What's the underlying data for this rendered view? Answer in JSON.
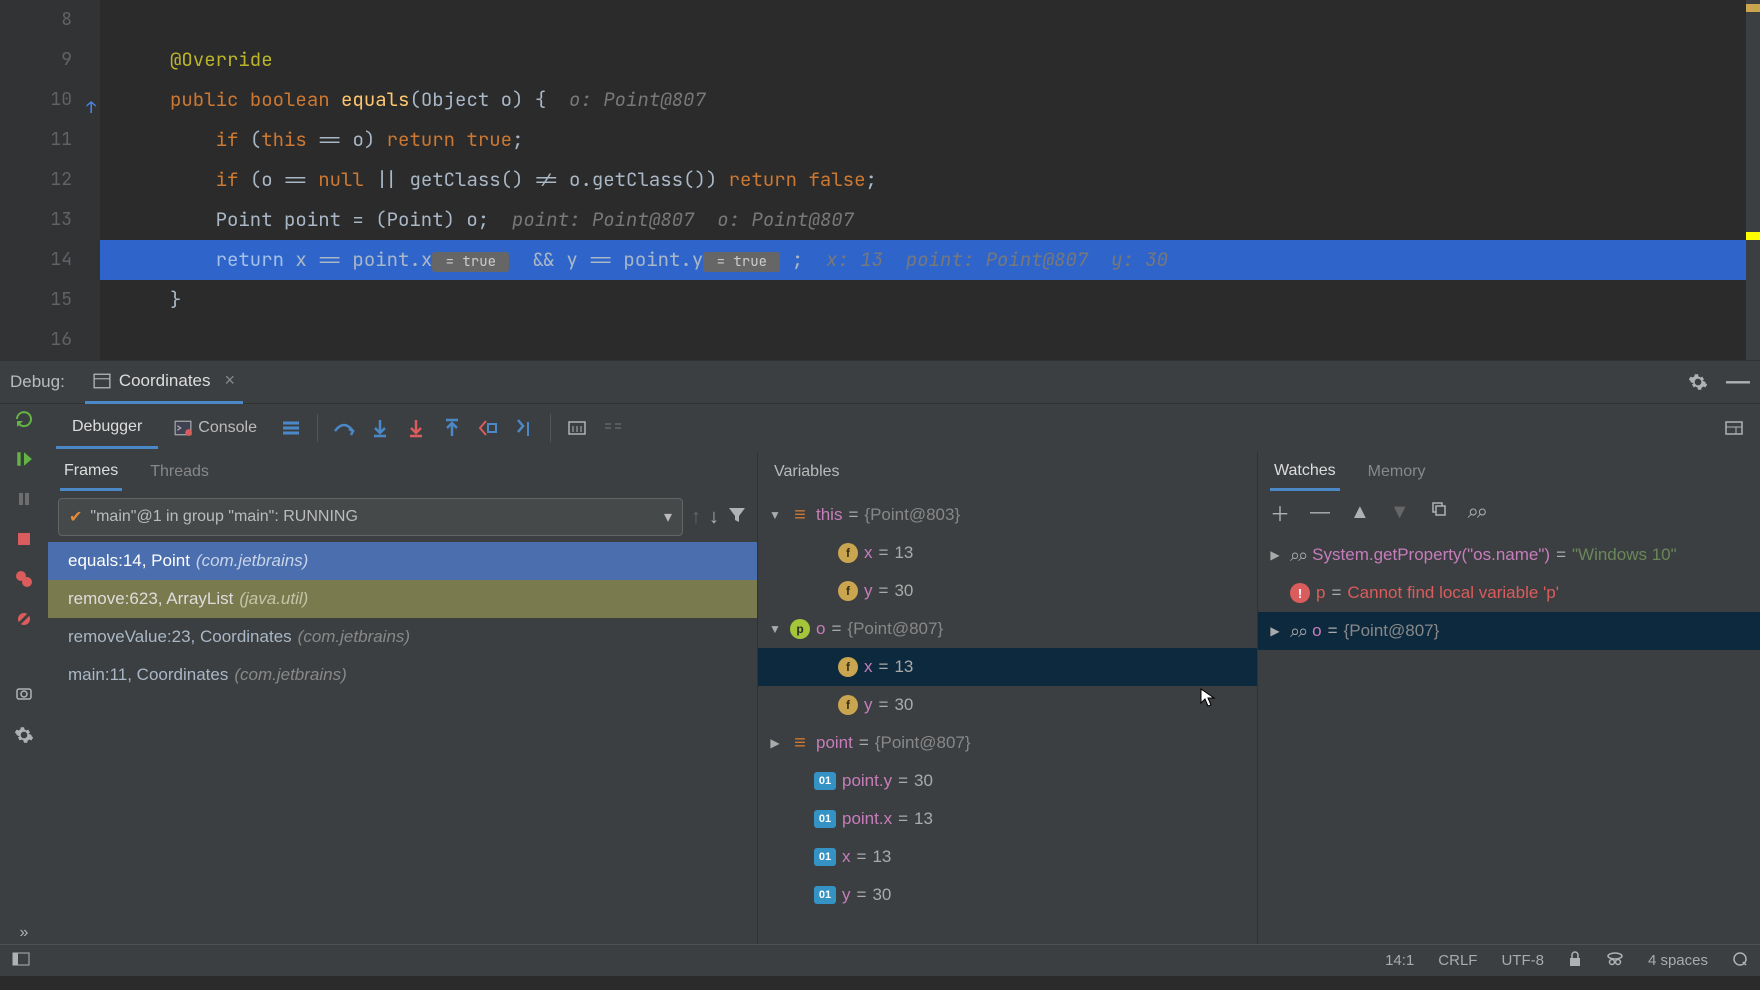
{
  "editor": {
    "lines": [
      {
        "num": "8"
      },
      {
        "num": "9"
      },
      {
        "num": "10"
      },
      {
        "num": "11"
      },
      {
        "num": "12"
      },
      {
        "num": "13"
      },
      {
        "num": "14"
      },
      {
        "num": "15"
      },
      {
        "num": "16"
      }
    ],
    "code": {
      "annotation": "@Override",
      "kw_public": "public",
      "kw_boolean": "boolean",
      "fn_equals": "equals",
      "sig_rest": "(Object o) {",
      "inline_sig": "  o: Point@807",
      "kw_if1": "if",
      "if1_body": " (",
      "kw_this": "this",
      "if1_body2": " == o) ",
      "kw_return1": "return",
      "kw_true": " true",
      "if1_end": ";",
      "kw_if2": "if",
      "if2_body": " (o == ",
      "kw_null": "null",
      "if2_body2": " || getClass() != o.getClass()) ",
      "kw_return2": "return",
      "kw_false": " false",
      "if2_end": ";",
      "l13_a": "Point point = (Point) o;",
      "l13_inline": "  point: Point@807  o: Point@807",
      "kw_return3": "return",
      "l14_a": " x == point.x",
      "l14_box1": " = true ",
      "l14_b": " && y == point.y",
      "l14_box2": " = true ",
      "l14_c": ";",
      "l14_inline": "  x: 13  point: Point@807  y: 30",
      "l15": "}"
    }
  },
  "debugHeader": {
    "label": "Debug:",
    "tabName": "Coordinates"
  },
  "toolbar": {
    "tabs": {
      "debugger": "Debugger",
      "console": "Console"
    }
  },
  "frames": {
    "tabs": {
      "frames": "Frames",
      "threads": "Threads"
    },
    "thread": "\"main\"@1 in group \"main\": RUNNING",
    "items": [
      {
        "text": "equals:14, Point",
        "pkg": "(com.jetbrains)",
        "state": "selected"
      },
      {
        "text": "remove:623, ArrayList",
        "pkg": "(java.util)",
        "state": "lib"
      },
      {
        "text": "removeValue:23, Coordinates",
        "pkg": "(com.jetbrains)",
        "state": ""
      },
      {
        "text": "main:11, Coordinates",
        "pkg": "(com.jetbrains)",
        "state": ""
      }
    ]
  },
  "variables": {
    "title": "Variables",
    "rows": [
      {
        "indent": 0,
        "arrow": "down",
        "badge": "class",
        "name": "this",
        "val": "{Point@803}",
        "valtype": "obj"
      },
      {
        "indent": 2,
        "arrow": "",
        "badge": "field",
        "name": "x",
        "val": "13",
        "valtype": "num"
      },
      {
        "indent": 2,
        "arrow": "",
        "badge": "field",
        "name": "y",
        "val": "30",
        "valtype": "num"
      },
      {
        "indent": 0,
        "arrow": "down",
        "badge": "param",
        "name": "o",
        "val": "{Point@807}",
        "valtype": "obj"
      },
      {
        "indent": 2,
        "arrow": "",
        "badge": "field",
        "name": "x",
        "val": "13",
        "valtype": "num",
        "selected": true
      },
      {
        "indent": 2,
        "arrow": "",
        "badge": "field",
        "name": "y",
        "val": "30",
        "valtype": "num"
      },
      {
        "indent": 0,
        "arrow": "right",
        "badge": "class",
        "name": "point",
        "val": "{Point@807}",
        "valtype": "obj"
      },
      {
        "indent": 1,
        "arrow": "",
        "badge": "int",
        "name": "point.y",
        "val": "30",
        "valtype": "num"
      },
      {
        "indent": 1,
        "arrow": "",
        "badge": "int",
        "name": "point.x",
        "val": "13",
        "valtype": "num"
      },
      {
        "indent": 1,
        "arrow": "",
        "badge": "int",
        "name": "x",
        "val": "13",
        "valtype": "num"
      },
      {
        "indent": 1,
        "arrow": "",
        "badge": "int",
        "name": "y",
        "val": "30",
        "valtype": "num"
      }
    ]
  },
  "watches": {
    "tabs": {
      "watches": "Watches",
      "memory": "Memory"
    },
    "rows": [
      {
        "arrow": "right",
        "badge": "glasses",
        "name": "System.getProperty(\"os.name\")",
        "val": "\"Windows 10\"",
        "valtype": "str"
      },
      {
        "arrow": "",
        "badge": "error",
        "name": "p",
        "val": "Cannot find local variable 'p'",
        "valtype": "err"
      },
      {
        "arrow": "right",
        "badge": "glasses",
        "name": "o",
        "val": "{Point@807}",
        "valtype": "obj",
        "selected": true
      }
    ]
  },
  "status": {
    "pos": "14:1",
    "lineend": "CRLF",
    "encoding": "UTF-8",
    "indent": "4 spaces"
  }
}
